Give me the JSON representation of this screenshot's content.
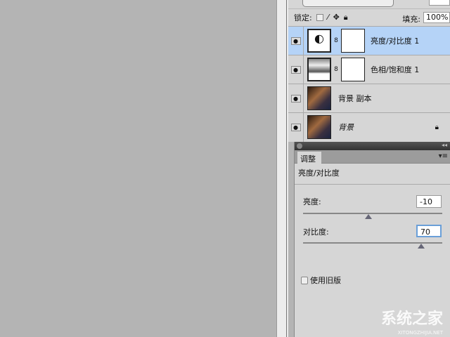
{
  "layers_panel": {
    "lock_label": "锁定:",
    "fill_label": "填充:",
    "fill_value": "100%",
    "layers": [
      {
        "name": "亮度/对比度 1",
        "type": "adjustment",
        "icon": "brightness-contrast-icon",
        "selected": true
      },
      {
        "name": "色相/饱和度 1",
        "type": "adjustment",
        "icon": "hue-saturation-icon",
        "selected": false
      },
      {
        "name": "背景 副本",
        "type": "image",
        "selected": false
      },
      {
        "name": "背景",
        "type": "image",
        "locked": true,
        "selected": false
      }
    ]
  },
  "adjustments_panel": {
    "tab": "调整",
    "title": "亮度/对比度",
    "brightness": {
      "label": "亮度:",
      "value": "-10",
      "fraction": 0.47
    },
    "contrast": {
      "label": "对比度:",
      "value": "70",
      "fraction": 0.85
    },
    "legacy_label": "使用旧版",
    "legacy_checked": false
  },
  "watermark": {
    "text": "系统之家",
    "url": "XITONGZHIJIA.NET"
  }
}
